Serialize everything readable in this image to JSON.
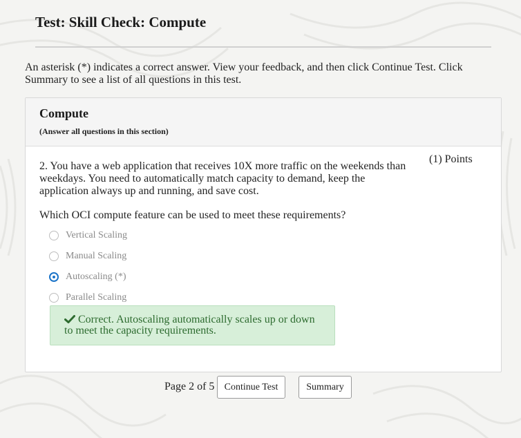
{
  "page": {
    "title": "Test: Skill Check: Compute",
    "instructions": "An asterisk (*) indicates a correct answer. View your feedback, and then click Continue Test. Click Summary to see a list of all questions in this test."
  },
  "section": {
    "title": "Compute",
    "note": "(Answer all questions in this section)"
  },
  "question": {
    "text": "2. You have a web application that receives 10X more traffic on the weekends than weekdays. You need to automatically match capacity to demand, keep the application always up and running, and save cost.",
    "points": "(1) Points",
    "prompt": "Which OCI compute feature can be used to meet these requirements?",
    "options": [
      {
        "label": "Vertical Scaling",
        "selected": false
      },
      {
        "label": "Manual Scaling",
        "selected": false
      },
      {
        "label": "Autoscaling (*)",
        "selected": true
      },
      {
        "label": "Parallel Scaling",
        "selected": false
      }
    ],
    "feedback": "Correct. Autoscaling automatically scales up or down to meet the capacity requirements.",
    "feedback_icon": "check-icon"
  },
  "pager": {
    "text": "Page 2 of 5",
    "continue_label": "Continue Test",
    "summary_label": "Summary"
  },
  "colors": {
    "accent": "#1a73c8",
    "feedback_bg": "#d7efd9",
    "feedback_text": "#2d6b2f"
  }
}
